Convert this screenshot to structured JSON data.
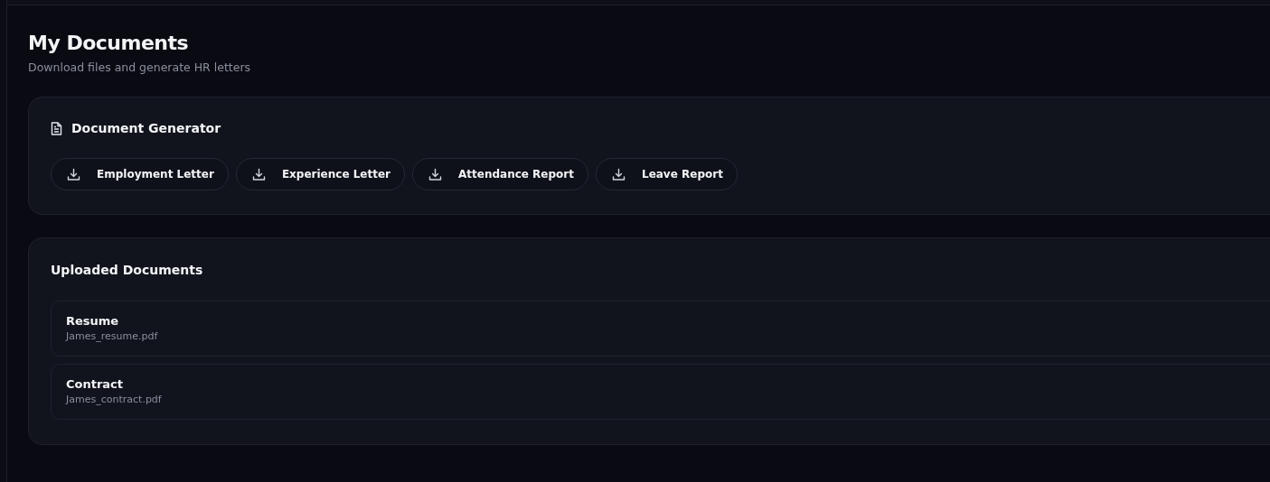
{
  "page": {
    "title": "My Documents",
    "subtitle": "Download files and generate HR letters"
  },
  "generator": {
    "title": "Document Generator",
    "buttons": [
      {
        "label": "Employment Letter"
      },
      {
        "label": "Experience Letter"
      },
      {
        "label": "Attendance Report"
      },
      {
        "label": "Leave Report"
      }
    ]
  },
  "uploaded": {
    "title": "Uploaded Documents",
    "items": [
      {
        "name": "Resume",
        "file": "James_resume.pdf"
      },
      {
        "name": "Contract",
        "file": "James_contract.pdf"
      }
    ]
  }
}
